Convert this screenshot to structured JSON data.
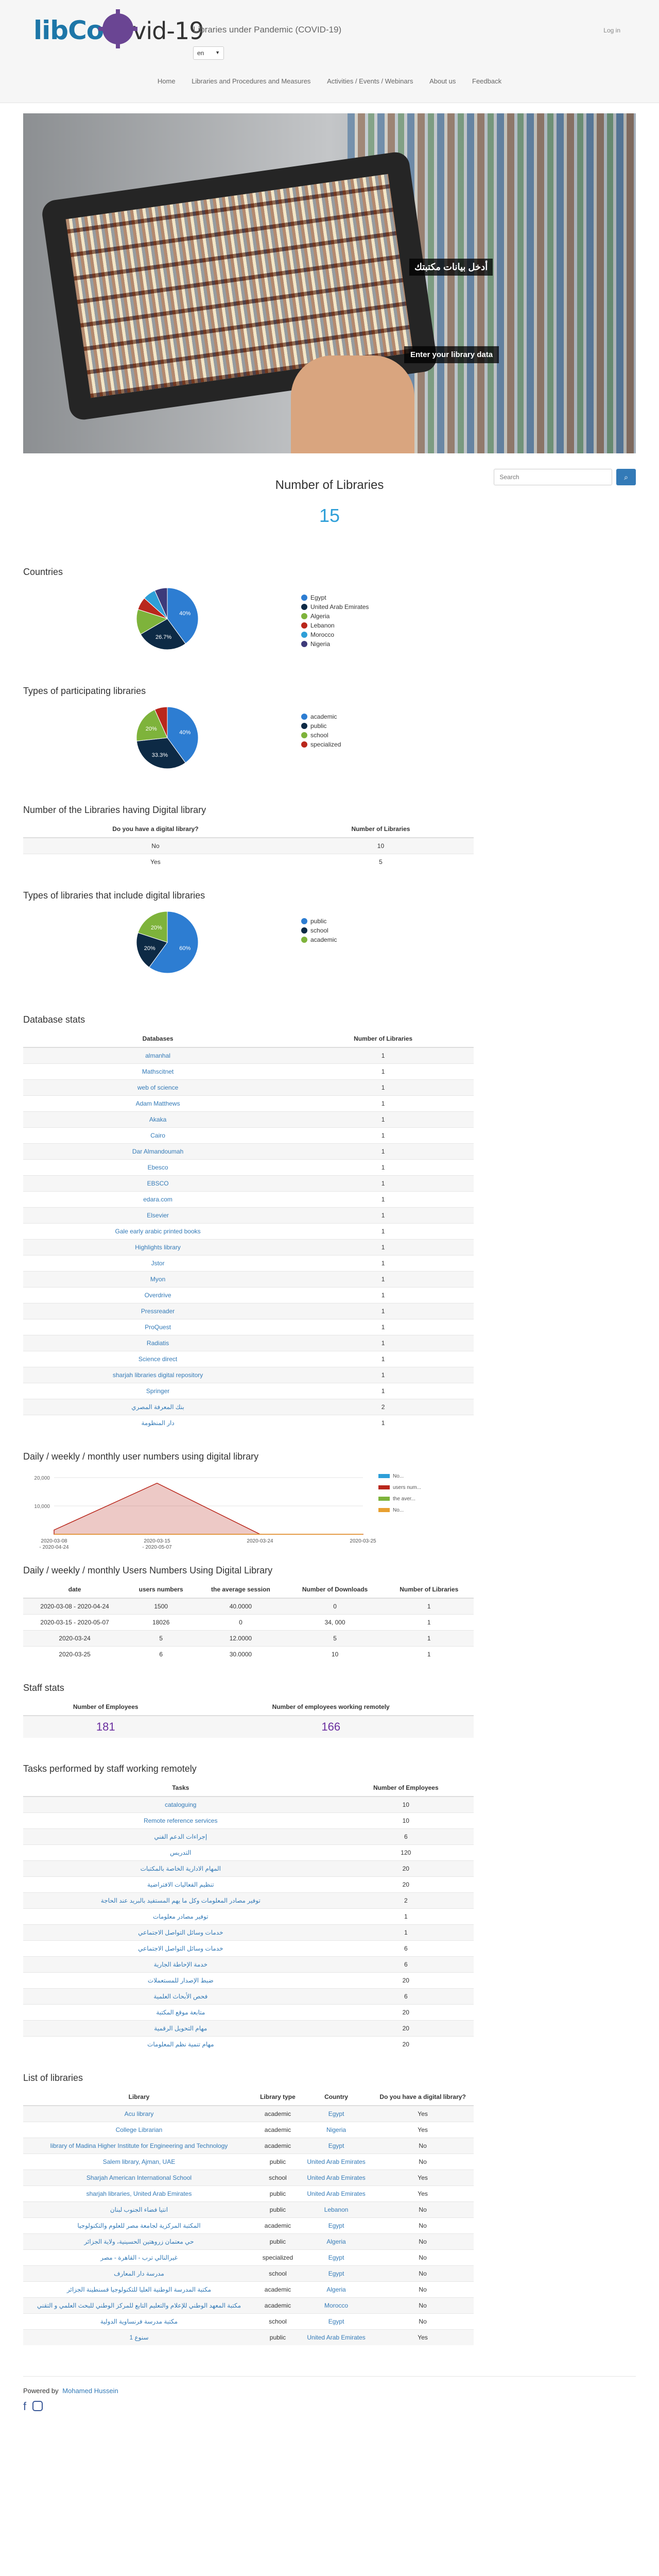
{
  "header": {
    "logo_lib": "lib",
    "logo_covid": "vid-19",
    "site_name": "Libraries under Pandemic (COVID-19)",
    "language": "en",
    "login": "Log in",
    "nav": [
      "Home",
      "Libraries and Procedures and Measures",
      "Activities / Events / Webinars",
      "About us",
      "Feedback"
    ]
  },
  "hero": {
    "caption_ar": "أدخل بيانات مكتبتك",
    "caption_en": "Enter your library data"
  },
  "search": {
    "placeholder": "Search",
    "button_icon": "search-icon"
  },
  "count": {
    "title": "Number of Libraries",
    "value": "15"
  },
  "sections": {
    "countries": "Countries",
    "types": "Types of participating libraries",
    "digital": "Number of the Libraries having Digital library",
    "types_digital": "Types of libraries that include digital libraries",
    "database": "Database stats",
    "daily": "Daily / weekly / monthly user numbers using digital library",
    "daily_table": "Daily / weekly / monthly Users Numbers Using Digital Library",
    "staff": "Staff stats",
    "tasks": "Tasks performed by staff working remotely",
    "list": "List of libraries"
  },
  "chart_data": [
    {
      "type": "pie",
      "labels": [
        "Egypt",
        "United Arab Emirates",
        "Algeria",
        "Lebanon",
        "Morocco",
        "Nigeria"
      ],
      "values": [
        40,
        26.7,
        13.3,
        6.7,
        6.7,
        6.7
      ],
      "data_labels": [
        "40%",
        "26.7%",
        "",
        "",
        "",
        ""
      ],
      "colors": [
        "#2d7dd2",
        "#0d2a45",
        "#7eb33b",
        "#b9271c",
        "#2e9fd8",
        "#3d3a7a"
      ],
      "legend_position": "right"
    },
    {
      "type": "pie",
      "labels": [
        "academic",
        "public",
        "school",
        "specialized"
      ],
      "values": [
        40,
        33.3,
        20,
        6.7
      ],
      "data_labels": [
        "40%",
        "33.3%",
        "20%",
        ""
      ],
      "colors": [
        "#2d7dd2",
        "#0d2a45",
        "#7eb33b",
        "#b9271c"
      ],
      "legend_position": "right"
    },
    {
      "type": "pie",
      "labels": [
        "public",
        "school",
        "academic"
      ],
      "values": [
        60,
        20,
        20
      ],
      "data_labels": [
        "60%",
        "20%",
        "20%"
      ],
      "colors": [
        "#2d7dd2",
        "#0d2a45",
        "#7eb33b"
      ],
      "legend_position": "right"
    },
    {
      "type": "area",
      "x": [
        "2020-03-08 - 2020-04-24",
        "2020-03-15 - 2020-05-07",
        "2020-03-24",
        "2020-03-25"
      ],
      "tick_labels": [
        "2020-03-08 - 2020-04-24",
        "2020-03-15 - 2020-05-07",
        "2020-03-24",
        "2020-03-25"
      ],
      "series": [
        {
          "name": "No...",
          "values": [
            1500,
            18026,
            5,
            6
          ]
        },
        {
          "name": "users num...",
          "values": [
            1500,
            18026,
            5,
            6
          ]
        },
        {
          "name": "the aver...",
          "values": [
            40000,
            0,
            12.0,
            30.0
          ]
        },
        {
          "name": "No...",
          "values": [
            0,
            34.0,
            5,
            10
          ]
        }
      ],
      "yticks": [
        "10,000",
        "20,000"
      ],
      "colors": [
        "#2e9fd8",
        "#b9271c",
        "#7eb33b",
        "#e8a030"
      ],
      "legend_position": "right"
    }
  ],
  "digital_table": {
    "headers": [
      "Do you have a digital library?",
      "Number of Libraries"
    ],
    "rows": [
      [
        "No",
        "10"
      ],
      [
        "Yes",
        "5"
      ]
    ]
  },
  "database_table": {
    "headers": [
      "Databases",
      "Number of Libraries"
    ],
    "rows": [
      [
        "almanhal",
        "1"
      ],
      [
        "Mathscitnet",
        "1"
      ],
      [
        "web of science",
        "1"
      ],
      [
        "Adam Matthews",
        "1"
      ],
      [
        "Akaka",
        "1"
      ],
      [
        "Cairo",
        "1"
      ],
      [
        "Dar Almandoumah",
        "1"
      ],
      [
        "Ebesco",
        "1"
      ],
      [
        "EBSCO",
        "1"
      ],
      [
        "edara.com",
        "1"
      ],
      [
        "Elsevier",
        "1"
      ],
      [
        "Gale early arabic printed books",
        "1"
      ],
      [
        "Highlights library",
        "1"
      ],
      [
        "Jstor",
        "1"
      ],
      [
        "Myon",
        "1"
      ],
      [
        "Overdrive",
        "1"
      ],
      [
        "Pressreader",
        "1"
      ],
      [
        "ProQuest",
        "1"
      ],
      [
        "Radiatis",
        "1"
      ],
      [
        "Science direct",
        "1"
      ],
      [
        "sharjah libraries digital repository",
        "1"
      ],
      [
        "Springer",
        "1"
      ],
      [
        "بنك المعرفة المصري",
        "2"
      ],
      [
        "دار المنظومة",
        "1"
      ]
    ]
  },
  "daily_table": {
    "headers": [
      "date",
      "users numbers",
      "the average session",
      "Number of Downloads",
      "Number of Libraries"
    ],
    "rows": [
      [
        "2020-03-08 - 2020-04-24",
        "1500",
        "40.0000",
        "0",
        "1"
      ],
      [
        "2020-03-15 - 2020-05-07",
        "18026",
        "0",
        "34, 000",
        "1"
      ],
      [
        "2020-03-24",
        "5",
        "12.0000",
        "5",
        "1"
      ],
      [
        "2020-03-25",
        "6",
        "30.0000",
        "10",
        "1"
      ]
    ]
  },
  "staff": {
    "headers": [
      "Number of Employees",
      "Number of employees working remotely"
    ],
    "values": [
      "181",
      "166"
    ]
  },
  "tasks_table": {
    "headers": [
      "Tasks",
      "Number of Employees"
    ],
    "rows": [
      [
        "cataloguing",
        "10"
      ],
      [
        "Remote reference services",
        "10"
      ],
      [
        "إجراءات الدعم الفني",
        "6"
      ],
      [
        "التدريس",
        "120"
      ],
      [
        "المهام الادارية الخاصة بالمكتبات",
        "20"
      ],
      [
        "تنظيم الفعاليات الافتراضية",
        "20"
      ],
      [
        "توفير مصادر المعلومات وكل ما يهم المستفيد بالبريد عند الحاجة",
        "2"
      ],
      [
        "توفير مصادر معلومات",
        "1"
      ],
      [
        "خدمات وسائل التواصل الاجتماعي",
        "1"
      ],
      [
        "خدمات وسائل التواصل الاجتماعي",
        "6"
      ],
      [
        "خدمة الإحاطة الجارية",
        "6"
      ],
      [
        "ضبط الإصدار للمستعملات",
        "20"
      ],
      [
        "فحص الأبحاث العلمية",
        "6"
      ],
      [
        "متابعة موقع المكتبة",
        "20"
      ],
      [
        "مهام التحويل الرقمية",
        "20"
      ],
      [
        "مهام تنمية نظم المعلومات",
        "20"
      ]
    ]
  },
  "libraries_table": {
    "headers": [
      "Library",
      "Library type",
      "Country",
      "Do you have a digital library?"
    ],
    "rows": [
      [
        "Acu library",
        "academic",
        "Egypt",
        "Yes"
      ],
      [
        "College Librarian",
        "academic",
        "Nigeria",
        "Yes"
      ],
      [
        "library of Madina Higher Institute for Engineering and Technology",
        "academic",
        "Egypt",
        "No"
      ],
      [
        "Salem library, Ajman, UAE",
        "public",
        "United Arab Emirates",
        "No"
      ],
      [
        "Sharjah American International School",
        "school",
        "United Arab Emirates",
        "Yes"
      ],
      [
        "sharjah libraries, United Arab Emirates",
        "public",
        "United Arab Emirates",
        "Yes"
      ],
      [
        "انتيا فضاء الجنوب لبنان",
        "public",
        "Lebanon",
        "No"
      ],
      [
        "المكتبة المركزية لجامعة مصر للعلوم والتكنولوجيا",
        "academic",
        "Egypt",
        "No"
      ],
      [
        "حي معتمان زروهتين الحسينية، ولاية الجزائر",
        "public",
        "Algeria",
        "No"
      ],
      [
        "غيرالنالي ترب - القاهرة - مصر",
        "specialized",
        "Egypt",
        "No"
      ],
      [
        "مدرسة دار المعارف",
        "school",
        "Egypt",
        "No"
      ],
      [
        "مكتبة المدرسة الوطنية العليا للتكنولوجيا قسنطينة الجزائر",
        "academic",
        "Algeria",
        "No"
      ],
      [
        "مكتبة المعهد الوطني للإعلام والتعليم التابع للمركز الوطني للبحث العلمي و التقني",
        "academic",
        "Morocco",
        "No"
      ],
      [
        "مكتبة مدرسة فرنساوية الدولية",
        "school",
        "Egypt",
        "No"
      ],
      [
        "سنوع 1",
        "public",
        "United Arab Emirates",
        "Yes"
      ]
    ]
  },
  "footer": {
    "powered_by": "Powered by",
    "author": "Mohamed Hussein",
    "social": [
      "facebook-icon",
      "instagram-icon"
    ]
  }
}
